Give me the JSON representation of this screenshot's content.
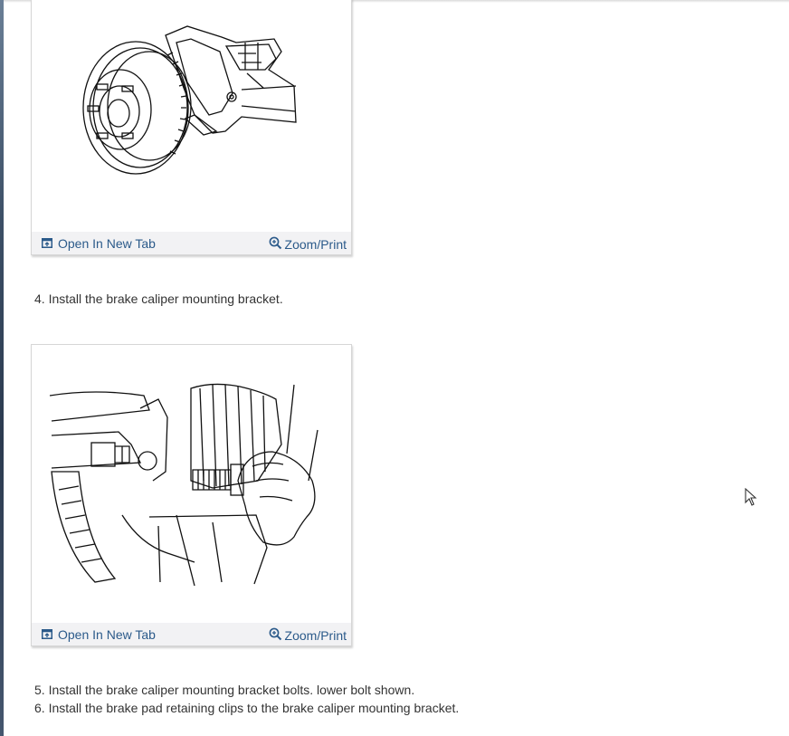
{
  "figures": [
    {
      "open_tab_label": "Open In New Tab",
      "zoom_label": "Zoom/Print",
      "open_tab_icon": "open-new-tab-icon",
      "zoom_icon": "zoom-in-icon"
    },
    {
      "open_tab_label": "Open In New Tab",
      "zoom_label": "Zoom/Print",
      "open_tab_icon": "open-new-tab-icon",
      "zoom_icon": "zoom-in-icon"
    }
  ],
  "steps": [
    "4. Install the brake caliper mounting bracket.",
    "5. Install the brake caliper mounting bracket bolts. lower bolt shown.",
    "6. Install the brake pad retaining clips to the brake caliper mounting bracket."
  ],
  "colors": {
    "link": "#2b5a8a",
    "toolbar_bg": "#f2f2f4",
    "text": "#333333"
  }
}
